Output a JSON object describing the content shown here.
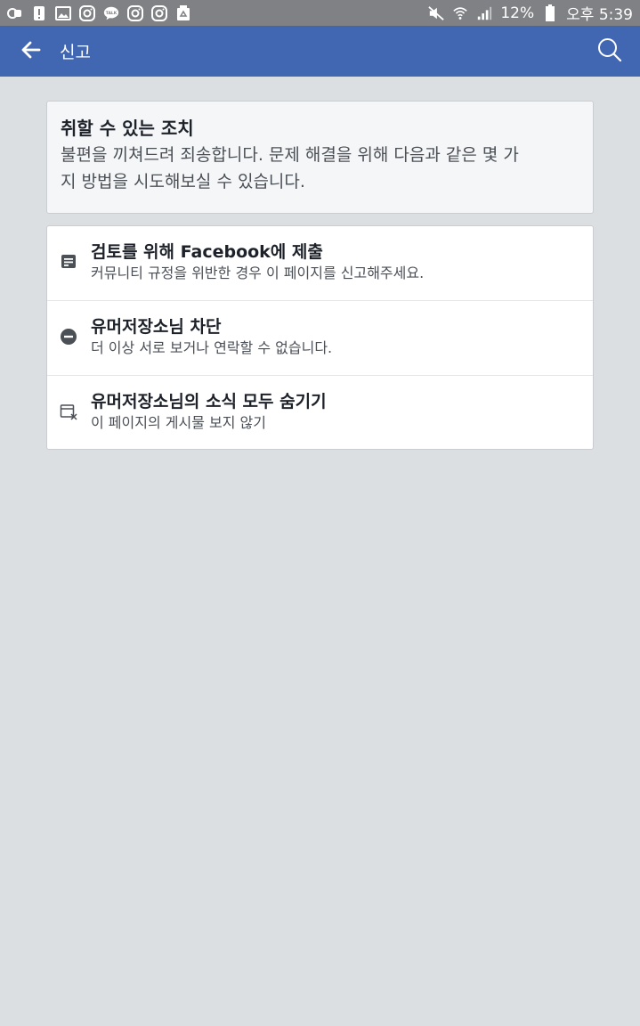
{
  "status_bar": {
    "battery_percent": "12%",
    "time": "오후 5:39",
    "left_icons": [
      "app-notification-icon",
      "alert-icon",
      "gallery-icon",
      "instagram-icon",
      "talk-icon",
      "instagram-icon",
      "instagram-icon",
      "recycle-icon"
    ],
    "right_icons": [
      "mute-icon",
      "wifi-icon",
      "signal-icon",
      "battery-icon"
    ]
  },
  "app_bar": {
    "title": "신고",
    "color": "#4267b2"
  },
  "info_card": {
    "title": "취할 수 있는 조치",
    "description_line1": "불편을 끼쳐드려 죄송합니다. 문제 해결을 위해 다음과 같은 몇 가",
    "description_line2": "지 방법을 시도해보실 수 있습니다."
  },
  "options": [
    {
      "icon": "report-document-icon",
      "title": "검토를 위해 Facebook에 제출",
      "subtitle": "커뮤니티 규정을 위반한 경우 이 페이지를 신고해주세요."
    },
    {
      "icon": "block-icon",
      "title": "유머저장소님 차단",
      "subtitle": "더 이상 서로 보거나 연락할 수 없습니다."
    },
    {
      "icon": "hide-feed-icon",
      "title": "유머저장소님의 소식 모두 숨기기",
      "subtitle": "이 페이지의 게시물 보지 않기"
    }
  ]
}
